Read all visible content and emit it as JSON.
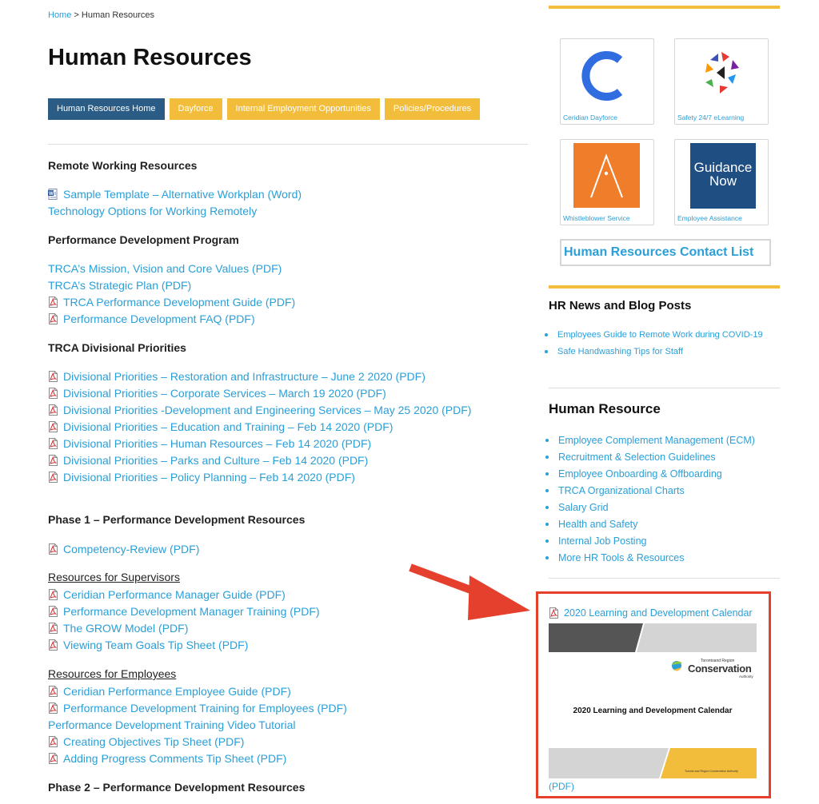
{
  "breadcrumb": {
    "home": "Home",
    "separator": " > ",
    "current": "Human Resources"
  },
  "page_title": "Human Resources",
  "tabs": [
    {
      "label": "Human Resources Home",
      "active": true
    },
    {
      "label": "Dayforce",
      "active": false
    },
    {
      "label": "Internal Employment Opportunities",
      "active": false
    },
    {
      "label": "Policies/Procedures",
      "active": false
    }
  ],
  "colors": {
    "link": "#2a9fd8",
    "tab_active": "#2b5c86",
    "tab": "#f3bd3c",
    "accent_bar": "#f3bd3c",
    "highlight": "#e5402e"
  },
  "sections": {
    "remote": {
      "heading": "Remote Working Resources",
      "items": [
        {
          "label": "Sample Template – Alternative Workplan (Word)",
          "icon": "word-icon"
        },
        {
          "label": "Technology Options for Working Remotely",
          "icon": ""
        }
      ]
    },
    "pdp": {
      "heading": "Performance Development Program",
      "items": [
        {
          "label": "TRCA’s Mission, Vision and Core Values (PDF)",
          "icon": ""
        },
        {
          "label": "TRCA’s Strategic Plan (PDF)",
          "icon": ""
        },
        {
          "label": "TRCA Performance Development Guide (PDF)",
          "icon": "pdf-icon"
        },
        {
          "label": "Performance Development FAQ (PDF)",
          "icon": "pdf-icon"
        }
      ]
    },
    "divisional": {
      "heading": "TRCA Divisional Priorities",
      "items": [
        {
          "label": "Divisional Priorities – Restoration and Infrastructure – June 2 2020 (PDF)"
        },
        {
          "label": "Divisional Priorities – Corporate Services – March 19 2020 (PDF)"
        },
        {
          "label": "Divisional Priorities -Development and Engineering Services – May 25 2020 (PDF)"
        },
        {
          "label": "Divisional Priorities – Education and Training – Feb 14 2020 (PDF)"
        },
        {
          "label": "Divisional Priorities – Human Resources – Feb 14 2020 (PDF)"
        },
        {
          "label": "Divisional Priorities – Parks and Culture – Feb 14 2020 (PDF)"
        },
        {
          "label": "Divisional Priorities – Policy Planning – Feb 14 2020 (PDF)"
        }
      ]
    },
    "phase1": {
      "heading": "Phase 1 – Performance Development Resources",
      "items": [
        {
          "label": "Competency-Review (PDF)"
        }
      ],
      "supervisors_heading": "Resources for Supervisors",
      "supervisors": [
        {
          "label": "Ceridian Performance Manager Guide (PDF)"
        },
        {
          "label": "Performance Development Manager Training (PDF)"
        },
        {
          "label": "The GROW Model (PDF)"
        },
        {
          "label": "Viewing Team Goals Tip Sheet (PDF)"
        }
      ],
      "employees_heading": "Resources for Employees",
      "employees": [
        {
          "label": "Ceridian Performance Employee Guide (PDF)",
          "icon": "pdf-icon"
        },
        {
          "label": "Performance Development Training for Employees (PDF)",
          "icon": "pdf-icon"
        },
        {
          "label": "Performance Development Training Video Tutorial",
          "icon": ""
        },
        {
          "label": "Creating Objectives Tip Sheet (PDF)",
          "icon": "pdf-icon"
        },
        {
          "label": "Adding Progress Comments Tip Sheet (PDF)",
          "icon": "pdf-icon"
        }
      ]
    },
    "phase2": {
      "heading": "Phase 2 – Performance Development Resources"
    }
  },
  "sidebar": {
    "tiles": [
      {
        "label": "Ceridian Dayforce",
        "icon": "ceridian-logo"
      },
      {
        "label": "Safety 24/7 eLearning",
        "icon": "safety-logo"
      },
      {
        "label": "Whistleblower Service",
        "icon": "whistleblower-logo"
      },
      {
        "label": "Employee Assistance",
        "icon": "guidance-now-logo",
        "logo_line1": "Guidance",
        "logo_line2": "Now"
      }
    ],
    "contact_list": "Human Resources Contact List",
    "news_heading": "HR News and Blog Posts",
    "news": [
      "Employees Guide to Remote Work during COVID-19",
      "Safe Handwashing Tips for Staff"
    ],
    "hr_heading": "Human Resource",
    "hr_links": [
      "Employee Complement Management (ECM)",
      "Recruitment & Selection Guidelines",
      "Employee Onboarding & Offboarding",
      "TRCA Organizational Charts",
      "Salary Grid",
      "Health and Safety",
      "Internal Job Posting",
      "More HR Tools & Resources"
    ],
    "calendar": {
      "link": "2020 Learning and Development Calendar",
      "thumb_title": "2020 Learning and Development Calendar",
      "logo_small": "Torontoand Region",
      "logo_big": "Conservation",
      "logo_sub": "Authority",
      "footer_text": "Toronto and Region Conservation Authority",
      "pdf": "(PDF)"
    }
  }
}
